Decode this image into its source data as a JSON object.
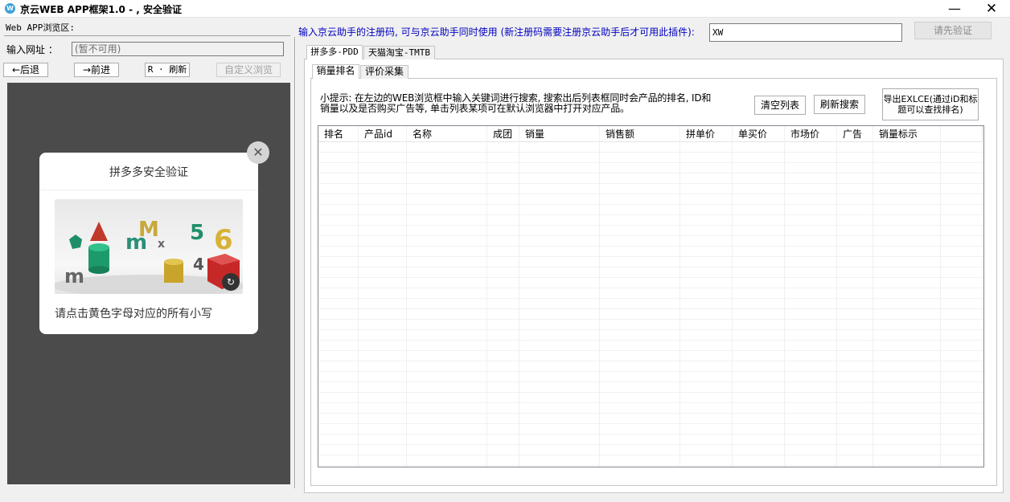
{
  "window": {
    "title": "京云WEB APP框架1.0 - , 安全验证",
    "app_icon": "globe-app-icon",
    "minimize_glyph": "—",
    "close_glyph": "✕"
  },
  "left": {
    "browse_label": "Web APP浏览区:",
    "url_label": "输入网址 ：",
    "url_value": "(暂不可用)",
    "back_label": "←后退",
    "forward_label": "→前进",
    "refresh_label": "R · 刷新",
    "custom_label": "自定义浏览"
  },
  "captcha": {
    "title": "拼多多安全验证",
    "hint": "请点击黄色字母对应的所有小写",
    "close_glyph": "✕",
    "reload_glyph": "↻"
  },
  "registration": {
    "label": "输入京云助手的注册码, 可与京云助手同时使用 (新注册码需要注册京云助手后才可用此插件):",
    "code_value": "XW",
    "verify_label": "请先验证"
  },
  "outer_tabs": [
    {
      "label": "拼多多-PDD",
      "active": true
    },
    {
      "label": "天猫淘宝-TMTB",
      "active": false
    }
  ],
  "inner_tabs": [
    {
      "label": "销量排名",
      "active": true
    },
    {
      "label": "评价采集",
      "active": false
    }
  ],
  "tip_text": "小提示: 在左边的WEB浏览框中输入关键词进行搜索, 搜索出后列表框同时会产品的排名, ID和销量以及是否购买广告等, 单击列表某项可在默认浏览器中打开对应产品。",
  "actions": {
    "clear_label": "清空列表",
    "refresh_search_label": "刷新搜索",
    "export_label": "导出EXLCE(通过iD和标题可以查找排名)"
  },
  "table": {
    "columns": [
      "排名",
      "产品id",
      "名称",
      "成团",
      "销量",
      "销售额",
      "拼单价",
      "单买价",
      "市场价",
      "广告",
      "销量标示"
    ],
    "rows": []
  }
}
